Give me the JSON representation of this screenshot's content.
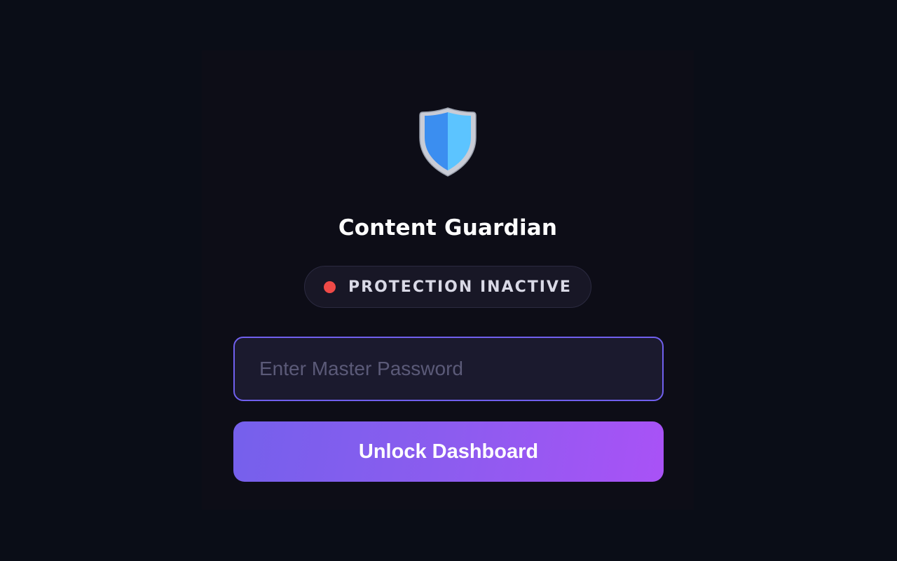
{
  "app": {
    "title": "Content Guardian",
    "logo_icon": "shield-icon"
  },
  "status": {
    "text": "PROTECTION INACTIVE",
    "indicator_color": "#ef4a47"
  },
  "password": {
    "value": "",
    "placeholder": "Enter Master Password"
  },
  "unlock": {
    "label": "Unlock Dashboard"
  },
  "colors": {
    "background": "#0a0d17",
    "panel": "#0d0d17",
    "accent_start": "#7560ec",
    "accent_end": "#a952f6",
    "input_border": "#7060ee"
  }
}
